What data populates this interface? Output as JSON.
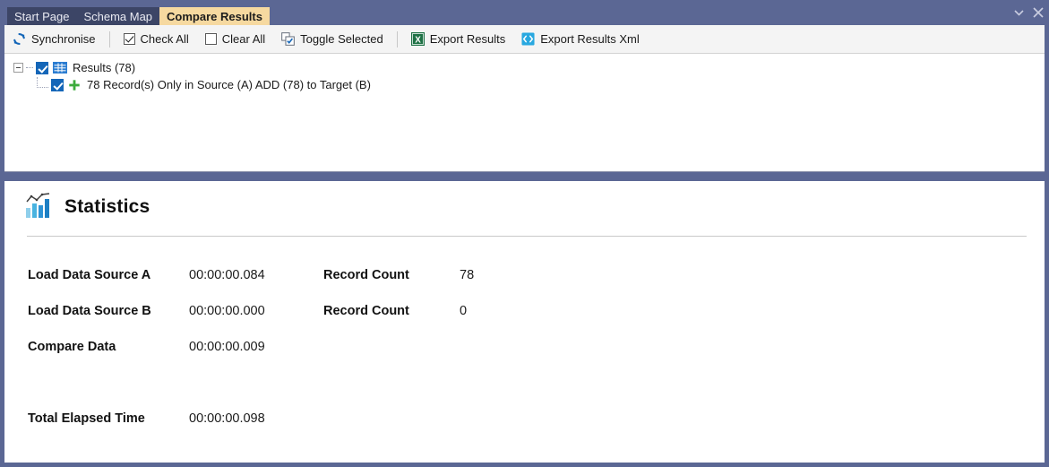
{
  "window": {
    "tabs": [
      {
        "label": "Start Page",
        "active": false
      },
      {
        "label": "Schema Map",
        "active": false
      },
      {
        "label": "Compare Results",
        "active": true
      }
    ],
    "controls": {
      "dropdown": "window-menu-chevron",
      "close": "close-window"
    }
  },
  "toolbar": {
    "synchronise_label": "Synchronise",
    "check_all_label": "Check All",
    "clear_all_label": "Clear All",
    "toggle_selected_label": "Toggle Selected",
    "export_results_label": "Export Results",
    "export_results_xml_label": "Export Results Xml"
  },
  "tree": {
    "root_label": "Results (78)",
    "child_label": "78 Record(s) Only in Source (A) ADD (78) to Target (B)"
  },
  "statistics": {
    "title": "Statistics",
    "rows": [
      {
        "label": "Load Data Source A",
        "value": "00:00:00.084",
        "label2": "Record Count",
        "value2": "78"
      },
      {
        "label": "Load Data Source B",
        "value": "00:00:00.000",
        "label2": "Record Count",
        "value2": "0"
      },
      {
        "label": "Compare Data",
        "value": "00:00:00.009",
        "label2": "",
        "value2": ""
      }
    ],
    "total": {
      "label": "Total Elapsed Time",
      "value": "00:00:00.098"
    }
  },
  "colors": {
    "chrome_blue": "#5b6794",
    "tab_inactive": "#3c4566",
    "tab_active": "#f6d9a0",
    "accent_blue": "#1466b8",
    "excel_green": "#1e7145",
    "xml_blue": "#29a8e0",
    "plus_green": "#3cab3c"
  }
}
